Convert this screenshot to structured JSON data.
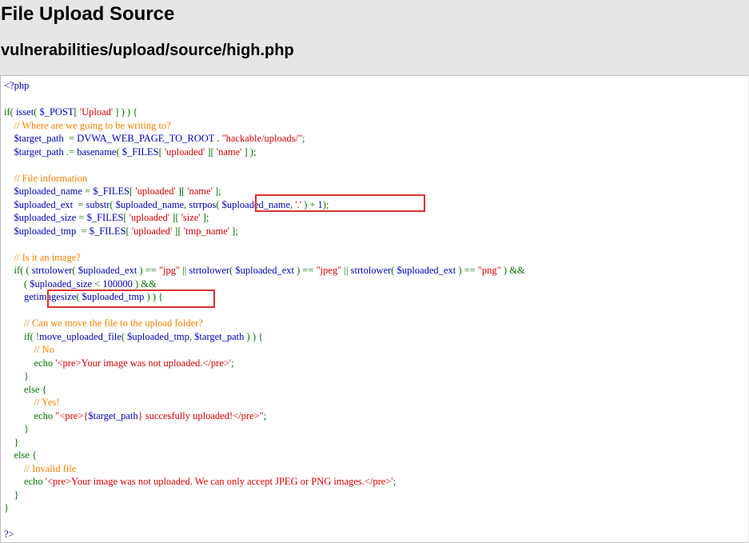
{
  "header": {
    "title": "File Upload Source",
    "file_path": "vulnerabilities/upload/source/high.php"
  },
  "code": {
    "lines": [
      [
        [
          "def",
          "<?php"
        ]
      ],
      [],
      [
        [
          "kw",
          "if( "
        ],
        [
          "def",
          "isset"
        ],
        [
          "kw",
          "( "
        ],
        [
          "def",
          "$_POST"
        ],
        [
          "kw",
          "[ "
        ],
        [
          "str",
          "'Upload'"
        ],
        [
          "kw",
          " ] ) ) {"
        ]
      ],
      [
        [
          "kw",
          "    "
        ],
        [
          "com",
          "// Where are we going to be writing to?"
        ]
      ],
      [
        [
          "kw",
          "    "
        ],
        [
          "def",
          "$target_path  "
        ],
        [
          "kw",
          "= "
        ],
        [
          "def",
          "DVWA_WEB_PAGE_TO_ROOT "
        ],
        [
          "kw",
          ". "
        ],
        [
          "str",
          "\"hackable/uploads/\""
        ],
        [
          "kw",
          ";"
        ]
      ],
      [
        [
          "kw",
          "    "
        ],
        [
          "def",
          "$target_path "
        ],
        [
          "kw",
          ".= "
        ],
        [
          "def",
          "basename"
        ],
        [
          "kw",
          "( "
        ],
        [
          "def",
          "$_FILES"
        ],
        [
          "kw",
          "[ "
        ],
        [
          "str",
          "'uploaded'"
        ],
        [
          "kw",
          " ][ "
        ],
        [
          "str",
          "'name'"
        ],
        [
          "kw",
          " ] );"
        ]
      ],
      [],
      [
        [
          "kw",
          "    "
        ],
        [
          "com",
          "// File information"
        ]
      ],
      [
        [
          "kw",
          "    "
        ],
        [
          "def",
          "$uploaded_name "
        ],
        [
          "kw",
          "= "
        ],
        [
          "def",
          "$_FILES"
        ],
        [
          "kw",
          "[ "
        ],
        [
          "str",
          "'uploaded'"
        ],
        [
          "kw",
          " ][ "
        ],
        [
          "str",
          "'name'"
        ],
        [
          "kw",
          " ];"
        ]
      ],
      [
        [
          "kw",
          "    "
        ],
        [
          "def",
          "$uploaded_ext  "
        ],
        [
          "kw",
          "= "
        ],
        [
          "def",
          "substr"
        ],
        [
          "kw",
          "( "
        ],
        [
          "def",
          "$uploaded_name"
        ],
        [
          "kw",
          ", "
        ],
        [
          "def",
          "strrpos"
        ],
        [
          "kw",
          "( "
        ],
        [
          "def",
          "$uploaded_name"
        ],
        [
          "kw",
          ", "
        ],
        [
          "str",
          "'.'"
        ],
        [
          "kw",
          " ) + "
        ],
        [
          "def",
          "1"
        ],
        [
          "kw",
          ");"
        ]
      ],
      [
        [
          "kw",
          "    "
        ],
        [
          "def",
          "$uploaded_size "
        ],
        [
          "kw",
          "= "
        ],
        [
          "def",
          "$_FILES"
        ],
        [
          "kw",
          "[ "
        ],
        [
          "str",
          "'uploaded'"
        ],
        [
          "kw",
          " ][ "
        ],
        [
          "str",
          "'size'"
        ],
        [
          "kw",
          " ];"
        ]
      ],
      [
        [
          "kw",
          "    "
        ],
        [
          "def",
          "$uploaded_tmp  "
        ],
        [
          "kw",
          "= "
        ],
        [
          "def",
          "$_FILES"
        ],
        [
          "kw",
          "[ "
        ],
        [
          "str",
          "'uploaded'"
        ],
        [
          "kw",
          " ][ "
        ],
        [
          "str",
          "'tmp_name'"
        ],
        [
          "kw",
          " ];"
        ]
      ],
      [],
      [
        [
          "kw",
          "    "
        ],
        [
          "com",
          "// Is it an image?"
        ]
      ],
      [
        [
          "kw",
          "    if( ( "
        ],
        [
          "def",
          "strtolower"
        ],
        [
          "kw",
          "( "
        ],
        [
          "def",
          "$uploaded_ext "
        ],
        [
          "kw",
          ") == "
        ],
        [
          "str",
          "\"jpg\""
        ],
        [
          "kw",
          " || "
        ],
        [
          "def",
          "strtolower"
        ],
        [
          "kw",
          "( "
        ],
        [
          "def",
          "$uploaded_ext "
        ],
        [
          "kw",
          ") == "
        ],
        [
          "str",
          "\"jpeg\""
        ],
        [
          "kw",
          " || "
        ],
        [
          "def",
          "strtolower"
        ],
        [
          "kw",
          "( "
        ],
        [
          "def",
          "$uploaded_ext "
        ],
        [
          "kw",
          ") == "
        ],
        [
          "str",
          "\"png\""
        ],
        [
          "kw",
          " ) &&"
        ]
      ],
      [
        [
          "kw",
          "        ( "
        ],
        [
          "def",
          "$uploaded_size "
        ],
        [
          "kw",
          "< "
        ],
        [
          "def",
          "100000 "
        ],
        [
          "kw",
          ") &&"
        ]
      ],
      [
        [
          "kw",
          "        "
        ],
        [
          "def",
          "getimagesize"
        ],
        [
          "kw",
          "( "
        ],
        [
          "def",
          "$uploaded_tmp "
        ],
        [
          "kw",
          ") ) {"
        ]
      ],
      [],
      [
        [
          "kw",
          "        "
        ],
        [
          "com",
          "// Can we move the file to the upload folder?"
        ]
      ],
      [
        [
          "kw",
          "        if( !"
        ],
        [
          "def",
          "move_uploaded_file"
        ],
        [
          "kw",
          "( "
        ],
        [
          "def",
          "$uploaded_tmp"
        ],
        [
          "kw",
          ", "
        ],
        [
          "def",
          "$target_path "
        ],
        [
          "kw",
          ") ) {"
        ]
      ],
      [
        [
          "kw",
          "            "
        ],
        [
          "com",
          "// No"
        ]
      ],
      [
        [
          "kw",
          "            echo "
        ],
        [
          "str",
          "'<pre>Your image was not uploaded.</pre>'"
        ],
        [
          "kw",
          ";"
        ]
      ],
      [
        [
          "kw",
          "        }"
        ]
      ],
      [
        [
          "kw",
          "        else {"
        ]
      ],
      [
        [
          "kw",
          "            "
        ],
        [
          "com",
          "// Yes!"
        ]
      ],
      [
        [
          "kw",
          "            echo "
        ],
        [
          "str",
          "\"<pre>{"
        ],
        [
          "def",
          "$target_path"
        ],
        [
          "str",
          "} succesfully uploaded!</pre>\""
        ],
        [
          "kw",
          ";"
        ]
      ],
      [
        [
          "kw",
          "        }"
        ]
      ],
      [
        [
          "kw",
          "    }"
        ]
      ],
      [
        [
          "kw",
          "    else {"
        ]
      ],
      [
        [
          "kw",
          "        "
        ],
        [
          "com",
          "// Invalid file"
        ]
      ],
      [
        [
          "kw",
          "        echo "
        ],
        [
          "str",
          "'<pre>Your image was not uploaded. We can only accept JPEG or PNG images.</pre>'"
        ],
        [
          "kw",
          ";"
        ]
      ],
      [
        [
          "kw",
          "    }"
        ]
      ],
      [
        [
          "kw",
          "}"
        ]
      ],
      [],
      [
        [
          "def",
          "?>"
        ]
      ]
    ]
  }
}
